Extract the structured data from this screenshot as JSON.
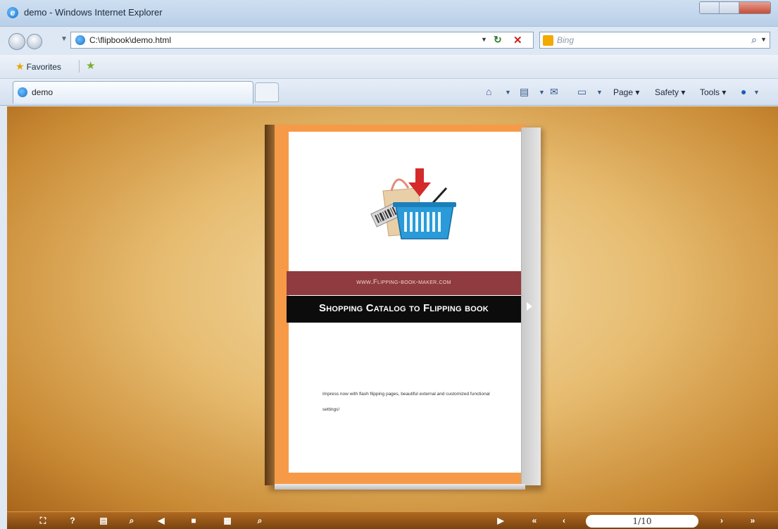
{
  "window": {
    "title": "demo - Windows Internet Explorer"
  },
  "address_bar": {
    "url": "C:\\flipbook\\demo.html"
  },
  "search": {
    "placeholder": "Bing"
  },
  "favorites_bar": {
    "favorites_label": "Favorites"
  },
  "tab": {
    "label": "demo"
  },
  "command_bar": {
    "page_label": "Page",
    "safety_label": "Safety",
    "tools_label": "Tools"
  },
  "book": {
    "site_url": "www.Flipping-book-maker.com",
    "title": "Shopping Catalog to Flipping book",
    "description": "Impress now with flash flipping pages, beautiful external and customized functional settings!"
  },
  "toolbar": {
    "page_indicator": "1/10",
    "icons": [
      "fullscreen-icon",
      "help-icon",
      "print-icon",
      "zoom-icon",
      "sound-icon",
      "share-icon",
      "thumbnails-icon",
      "search-icon",
      "autoplay-icon",
      "first-page-icon",
      "previous-page-icon",
      "next-page-icon",
      "last-page-icon"
    ]
  },
  "colors": {
    "cover_orange": "#f79a48",
    "url_band": "#8f3b3f",
    "title_band": "#0c0c0c",
    "toolbar_brown": "#8a4f15"
  }
}
